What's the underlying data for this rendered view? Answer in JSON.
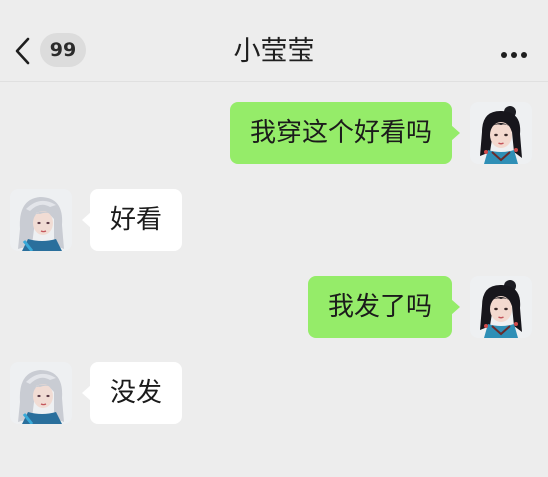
{
  "header": {
    "back_icon": "chevron-left-icon",
    "unread_badge": "99",
    "title": "小莹莹",
    "more_icon": "more-dots-icon"
  },
  "messages": [
    {
      "sender": "me",
      "text": "我穿这个好看吗"
    },
    {
      "sender": "contact",
      "text": "好看"
    },
    {
      "sender": "me",
      "text": "我发了吗"
    },
    {
      "sender": "contact",
      "text": "没发"
    }
  ],
  "colors": {
    "background": "#ededed",
    "my_bubble": "#95ec69",
    "their_bubble": "#ffffff",
    "badge": "#dcdcdc"
  }
}
